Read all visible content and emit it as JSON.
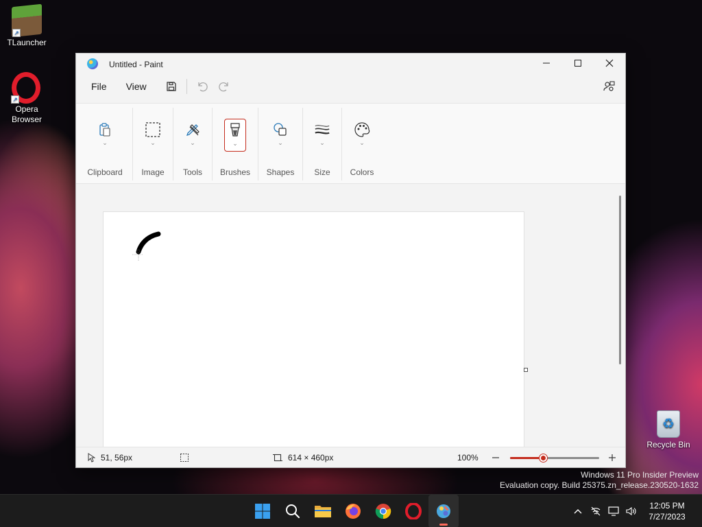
{
  "desktop": {
    "icons": [
      {
        "label": "TLauncher"
      },
      {
        "label": "Opera Browser"
      },
      {
        "label": "Recycle Bin"
      }
    ],
    "watermark": {
      "line1": "Windows 11 Pro Insider Preview",
      "line2": "Evaluation copy. Build 25375.zn_release.230520-1632"
    }
  },
  "window": {
    "title": "Untitled - Paint",
    "menu": {
      "file": "File",
      "view": "View"
    },
    "ribbon": {
      "groups": [
        {
          "label": "Clipboard",
          "icon": "clipboard-icon"
        },
        {
          "label": "Image",
          "icon": "selection-icon"
        },
        {
          "label": "Tools",
          "icon": "pencil-eraser-icon"
        },
        {
          "label": "Brushes",
          "icon": "brush-icon",
          "selected": true
        },
        {
          "label": "Shapes",
          "icon": "shapes-icon"
        },
        {
          "label": "Size",
          "icon": "line-size-icon"
        },
        {
          "label": "Colors",
          "icon": "palette-icon"
        }
      ]
    },
    "status": {
      "cursor_position": "51, 56px",
      "canvas_size": "614 × 460px",
      "zoom": "100%",
      "zoom_level": 0.38
    },
    "accent": "#c42b1c"
  },
  "taskbar": {
    "apps": [
      "start-icon",
      "search-icon",
      "file-explorer-icon",
      "firefox-icon",
      "chrome-icon",
      "opera-icon",
      "paint-icon"
    ],
    "clock": {
      "time": "12:05 PM",
      "date": "7/27/2023"
    }
  }
}
